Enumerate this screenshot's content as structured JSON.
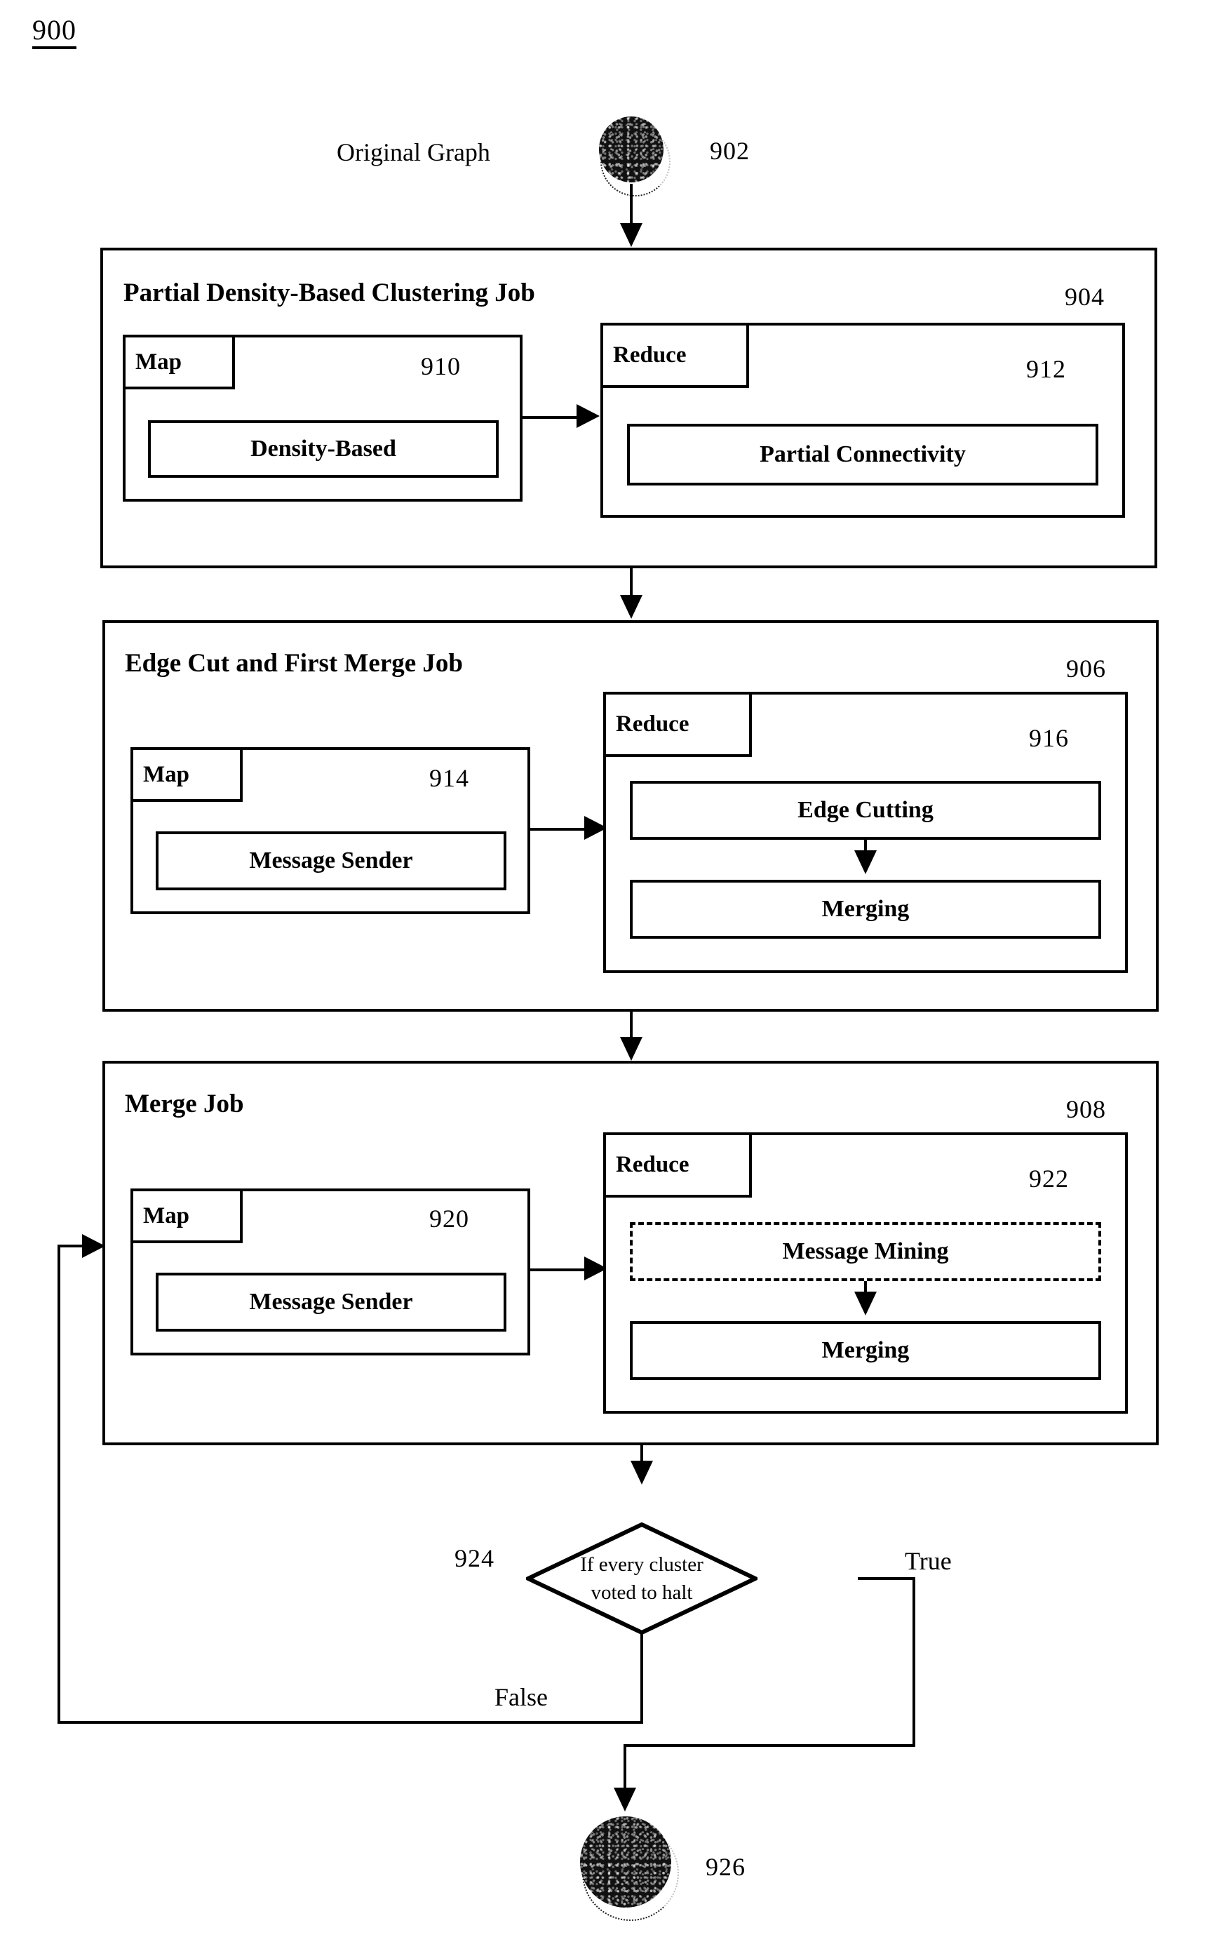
{
  "figure": {
    "number": "900"
  },
  "start_node": {
    "ref": "902",
    "caption": "Original Graph"
  },
  "end_node": {
    "ref": "926"
  },
  "jobs": [
    {
      "title": "Partial Density-Based Clustering Job",
      "ref": "904",
      "map": {
        "tab_label": "Map",
        "ref": "910",
        "operations": [
          "Density-Based"
        ]
      },
      "reduce": {
        "tab_label": "Reduce",
        "ref": "912",
        "operations": [
          "Partial Connectivity"
        ]
      }
    },
    {
      "title": "Edge Cut and First Merge Job",
      "ref": "906",
      "map": {
        "tab_label": "Map",
        "ref": "914",
        "operations": [
          "Message Sender"
        ]
      },
      "reduce": {
        "tab_label": "Reduce",
        "ref": "916",
        "operations": [
          "Edge Cutting",
          "Merging"
        ]
      }
    },
    {
      "title": "Merge Job",
      "ref": "908",
      "map": {
        "tab_label": "Map",
        "ref": "920",
        "operations": [
          "Message Sender"
        ]
      },
      "reduce": {
        "tab_label": "Reduce",
        "ref": "922",
        "operations": [
          "Message Mining",
          "Merging"
        ]
      }
    }
  ],
  "decision": {
    "ref": "924",
    "text_line1": "If every cluster",
    "text_line2": "voted to halt",
    "true_label": "True",
    "false_label": "False"
  },
  "colors": {
    "stroke": "#000000",
    "background": "#ffffff",
    "node_fill": "#111111"
  }
}
